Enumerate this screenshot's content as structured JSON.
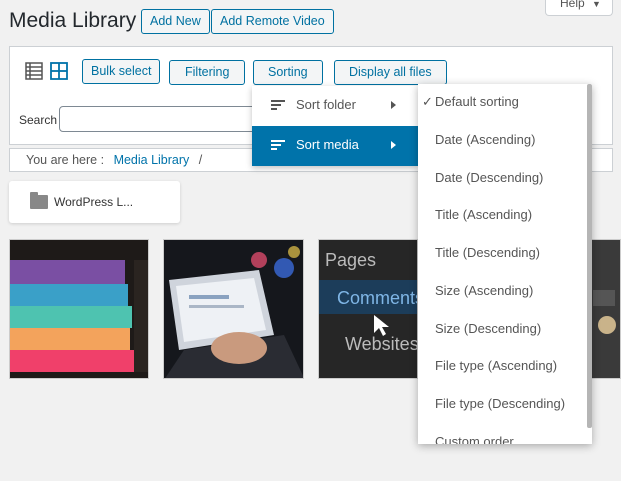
{
  "header": {
    "title": "Media Library",
    "add_new": "Add New",
    "add_remote": "Add Remote Video",
    "help": "Help"
  },
  "toolbar": {
    "bulk_select": "Bulk select",
    "filtering": "Filtering",
    "sorting": "Sorting",
    "display_all": "Display all files",
    "search_label": "Search",
    "search_value": ""
  },
  "breadcrumb": {
    "prefix": "You are here :",
    "link": "Media Library",
    "separator": "/"
  },
  "folder": {
    "name": "WordPress L..."
  },
  "sort_menu": {
    "items": [
      {
        "label": "Sort folder",
        "active": false
      },
      {
        "label": "Sort media",
        "active": true
      }
    ]
  },
  "sort_options": [
    {
      "label": "Default sorting",
      "checked": true
    },
    {
      "label": "Date (Ascending)",
      "checked": false
    },
    {
      "label": "Date (Descending)",
      "checked": false
    },
    {
      "label": "Title (Ascending)",
      "checked": false
    },
    {
      "label": "Title (Descending)",
      "checked": false
    },
    {
      "label": "Size (Ascending)",
      "checked": false
    },
    {
      "label": "Size (Descending)",
      "checked": false
    },
    {
      "label": "File type (Ascending)",
      "checked": false
    },
    {
      "label": "File type (Descending)",
      "checked": false
    },
    {
      "label": "Custom order",
      "checked": false
    }
  ],
  "thumbnails": {
    "text_pages": "Pages",
    "text_comments": "Comments",
    "text_websites": "Websites"
  },
  "colors": {
    "accent": "#0073aa",
    "button_border": "#0071a1"
  }
}
